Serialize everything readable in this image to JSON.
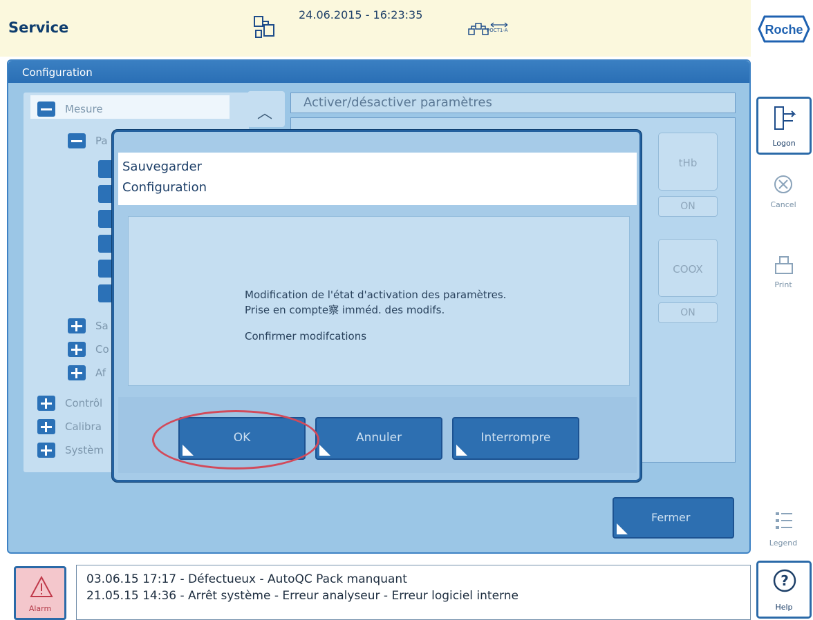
{
  "header": {
    "title": "Service",
    "datetime": "24.06.2015 - 16:23:35",
    "network_label": "POCT1-A",
    "brand_logo": "Roche"
  },
  "panel": {
    "title": "Configuration",
    "section_title": "Activer/désactiver paramètres",
    "tree": [
      {
        "label": "Mesure",
        "icon": "minus"
      },
      {
        "label": "Pa",
        "icon": "minus"
      },
      {
        "label": "Sa",
        "icon": "plus"
      },
      {
        "label": "Co",
        "icon": "plus"
      },
      {
        "label": "Af",
        "icon": "plus"
      },
      {
        "label": "Contrôl",
        "icon": "plus"
      },
      {
        "label": "Calibra",
        "icon": "plus"
      },
      {
        "label": "Systèm",
        "icon": "plus"
      }
    ],
    "params": [
      {
        "name": "tHb",
        "state": "ON"
      },
      {
        "name": "COOX",
        "state": "ON"
      }
    ],
    "close_button": "Fermer"
  },
  "dialog": {
    "title_line1": "Sauvegarder",
    "title_line2": "Configuration",
    "message_line1": "Modification de l'état d'activation des paramètres.",
    "message_line2": "Prise en compte察 imméd. des modifs.",
    "message_line3": "Confirmer modifcations",
    "buttons": {
      "ok": "OK",
      "cancel": "Annuler",
      "abort": "Interrompre"
    }
  },
  "sidebar": {
    "logon": "Logon",
    "cancel": "Cancel",
    "print": "Print",
    "legend": "Legend",
    "help": "Help"
  },
  "alarm": {
    "label": "Alarm"
  },
  "messages": {
    "line1": "03.06.15 17:17 - Défectueux - AutoQC Pack manquant",
    "line2": "21.05.15 14:36 - Arrêt système - Erreur analyseur - Erreur logiciel interne"
  },
  "colors": {
    "accent": "#2d6fb1",
    "header_bg": "#fbf8dd",
    "panel_bg": "#9bc6e6",
    "highlight": "#d24a5a",
    "alarm": "#b33a48"
  }
}
